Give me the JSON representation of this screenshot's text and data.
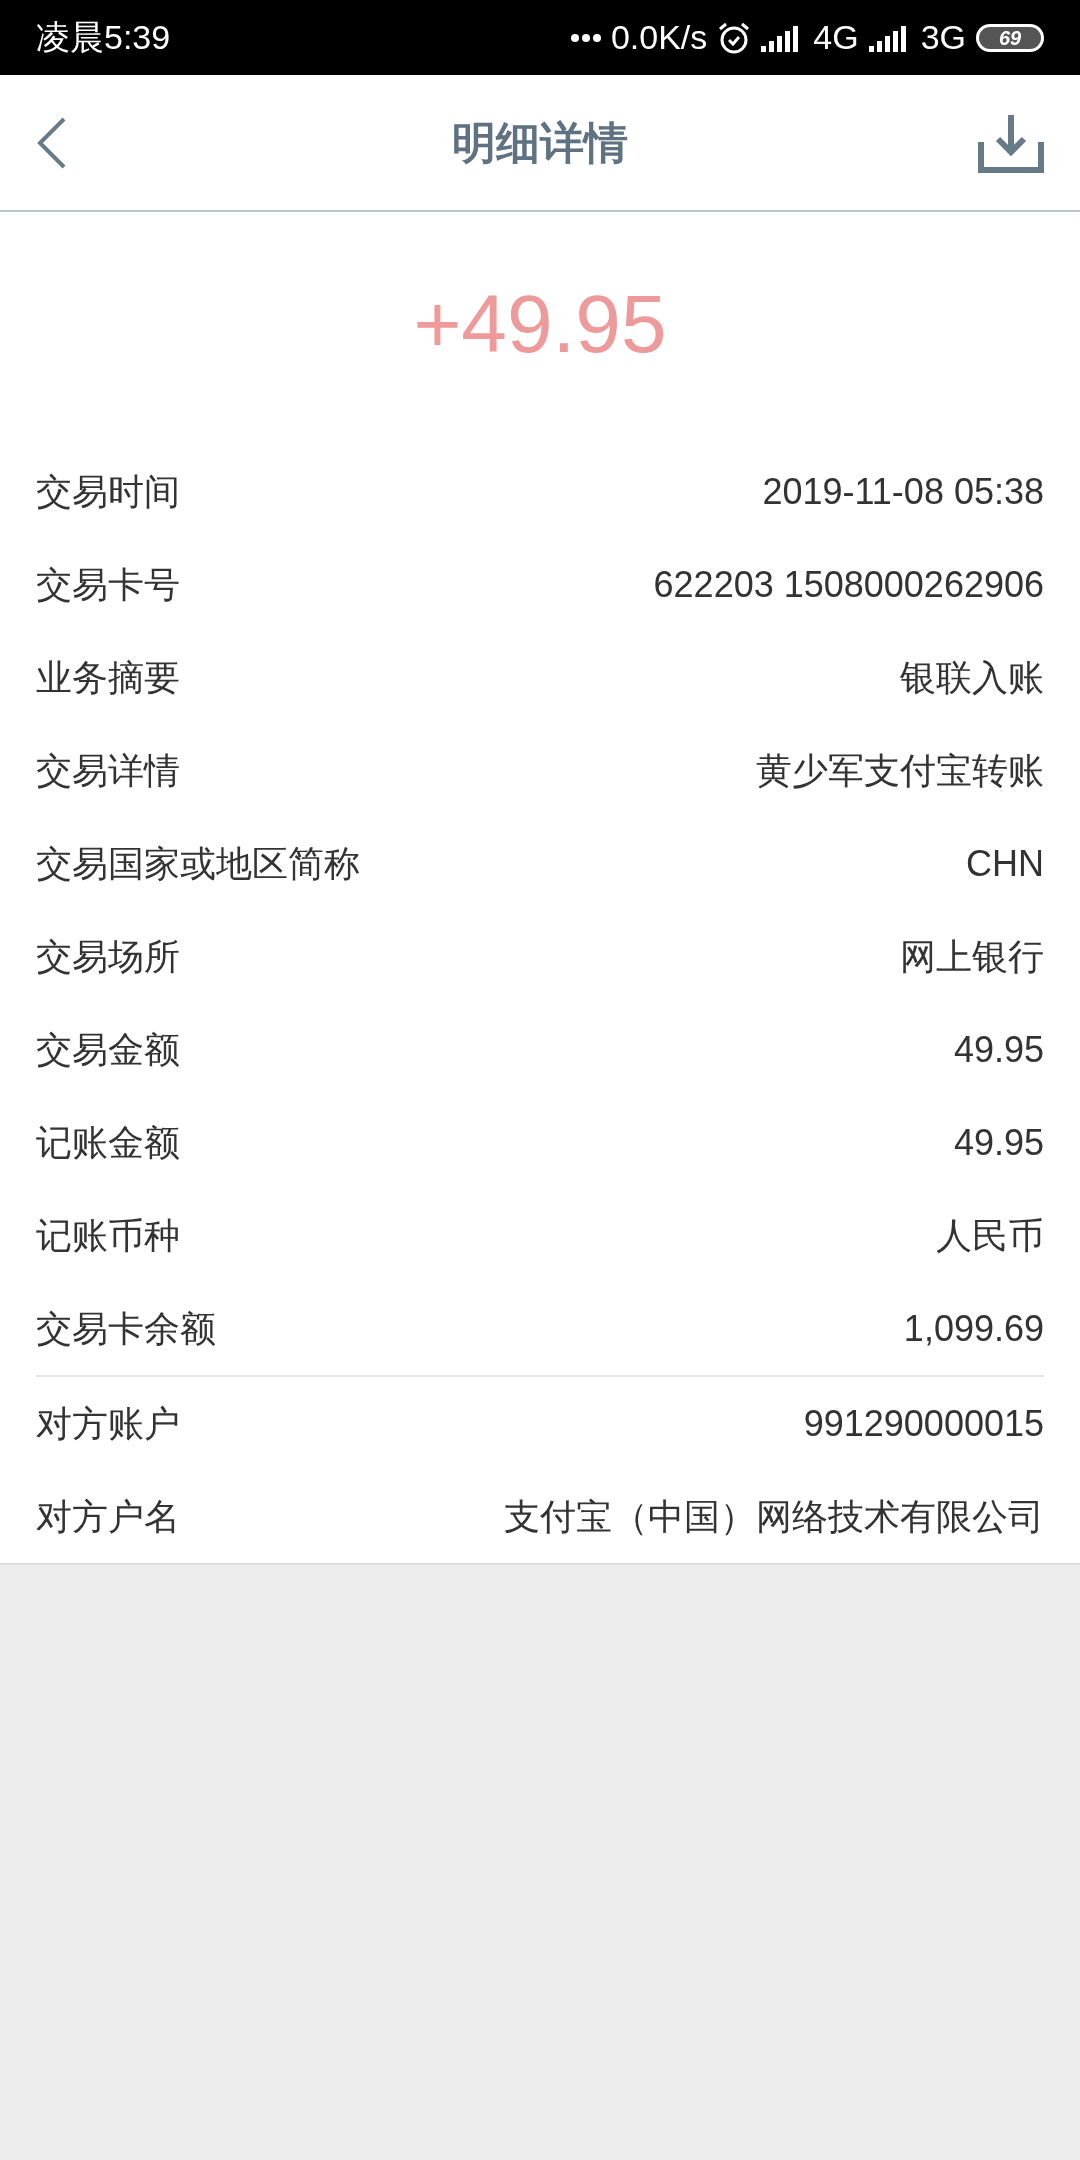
{
  "status_bar": {
    "time": "凌晨5:39",
    "net_speed": "0.0K/s",
    "network_1": "4G",
    "network_2": "3G",
    "battery": "69"
  },
  "header": {
    "title": "明细详情"
  },
  "amount": "+49.95",
  "groups": [
    {
      "rows": [
        {
          "label": "交易时间",
          "value": "2019-11-08 05:38"
        },
        {
          "label": "交易卡号",
          "value": "622203 1508000262906"
        },
        {
          "label": "业务摘要",
          "value": "银联入账"
        },
        {
          "label": "交易详情",
          "value": "黄少军支付宝转账"
        },
        {
          "label": "交易国家或地区简称",
          "value": "CHN"
        },
        {
          "label": "交易场所",
          "value": "网上银行"
        },
        {
          "label": "交易金额",
          "value": "49.95"
        },
        {
          "label": "记账金额",
          "value": "49.95"
        },
        {
          "label": "记账币种",
          "value": "人民币"
        },
        {
          "label": "交易卡余额",
          "value": "1,099.69"
        }
      ]
    },
    {
      "rows": [
        {
          "label": "对方账户",
          "value": "991290000015"
        },
        {
          "label": "对方户名",
          "value": "支付宝（中国）网络技术有限公司"
        }
      ]
    }
  ]
}
